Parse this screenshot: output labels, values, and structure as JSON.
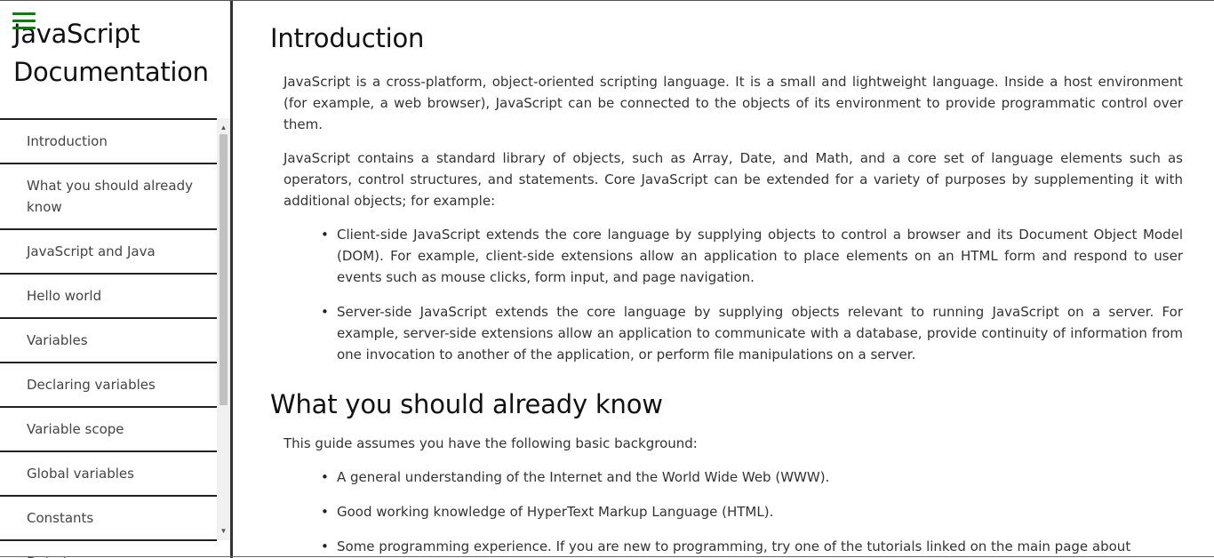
{
  "nav": {
    "title": "JavaScript Documentation",
    "menu_icon": "hamburger-menu-icon",
    "items": [
      "Introduction",
      "What you should already know",
      "JavaScript and Java",
      "Hello world",
      "Variables",
      "Declaring variables",
      "Variable scope",
      "Global variables",
      "Constants",
      "Data types"
    ]
  },
  "sections": {
    "intro": {
      "title": "Introduction",
      "p1": "JavaScript is a cross-platform, object-oriented scripting language. It is a small and lightweight language. Inside a host environment (for example, a web browser), JavaScript can be connected to the objects of its environment to provide programmatic control over them.",
      "p2": "JavaScript contains a standard library of objects, such as Array, Date, and Math, and a core set of language elements such as operators, control structures, and statements. Core JavaScript can be extended for a variety of purposes by supplementing it with additional objects; for example:",
      "bullets": [
        "Client-side JavaScript extends the core language by supplying objects to control a browser and its Document Object Model (DOM). For example, client-side extensions allow an application to place elements on an HTML form and respond to user events such as mouse clicks, form input, and page navigation.",
        "Server-side JavaScript extends the core language by supplying objects relevant to running JavaScript on a server. For example, server-side extensions allow an application to communicate with a database, provide continuity of information from one invocation to another of the application, or perform file manipulations on a server."
      ]
    },
    "know": {
      "title": "What you should already know",
      "p1": "This guide assumes you have the following basic background:",
      "bullets": [
        "A general understanding of the Internet and the World Wide Web (WWW).",
        "Good working knowledge of HyperText Markup Language (HTML).",
        "Some programming experience. If you are new to programming, try one of the tutorials linked on the main page about"
      ]
    }
  },
  "colors": {
    "accent": "#0a7d0a",
    "border": "#222222"
  }
}
